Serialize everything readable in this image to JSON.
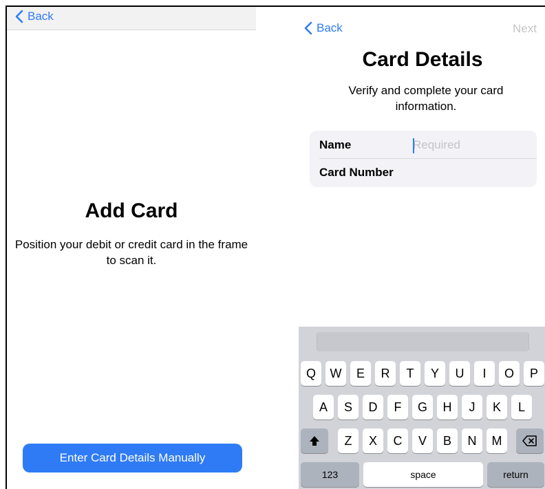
{
  "left_screen": {
    "back_label": "Back",
    "title": "Add Card",
    "subtitle": "Position your debit or credit card in the frame to scan it.",
    "manual_button_label": "Enter Card Details Manually"
  },
  "right_screen": {
    "back_label": "Back",
    "next_label": "Next",
    "title": "Card Details",
    "subtitle": "Verify and complete your card information.",
    "fields": [
      {
        "label": "Name",
        "value": "",
        "placeholder": "Required"
      },
      {
        "label": "Card Number",
        "value": "",
        "placeholder": ""
      }
    ]
  },
  "keyboard": {
    "row1": [
      "Q",
      "W",
      "E",
      "R",
      "T",
      "Y",
      "U",
      "I",
      "O",
      "P"
    ],
    "row2": [
      "A",
      "S",
      "D",
      "F",
      "G",
      "H",
      "J",
      "K",
      "L"
    ],
    "row3": [
      "Z",
      "X",
      "C",
      "V",
      "B",
      "N",
      "M"
    ],
    "numbers_label": "123",
    "space_label": "space",
    "return_label": "return",
    "shift_icon": "shift-arrow-up",
    "delete_icon": "backspace"
  },
  "colors": {
    "accent": "#2f7bf6",
    "disabled_text": "#c4c4c6",
    "keyboard_bg": "#d1d3d9",
    "field_group_bg": "#f2f2f7"
  }
}
